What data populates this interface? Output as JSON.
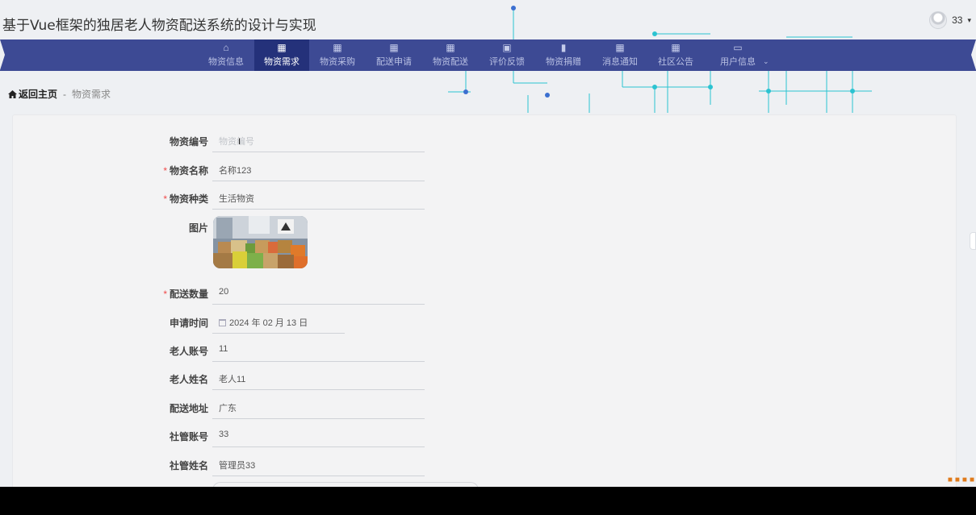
{
  "app": {
    "title": "基于Vue框架的独居老人物资配送系统的设计与实现"
  },
  "user": {
    "name": "33",
    "caret": "▾"
  },
  "nav": {
    "items": [
      {
        "label": "物资信息",
        "icon": "house-icon",
        "glyph": "⌂"
      },
      {
        "label": "物资需求",
        "icon": "grid-icon",
        "glyph": "▦",
        "active": true
      },
      {
        "label": "物资采购",
        "icon": "grid-icon",
        "glyph": "▦"
      },
      {
        "label": "配送申请",
        "icon": "grid-icon",
        "glyph": "▦"
      },
      {
        "label": "物资配送",
        "icon": "grid-dense-icon",
        "glyph": "▦"
      },
      {
        "label": "评价反馈",
        "icon": "clipboard-icon",
        "glyph": "▣"
      },
      {
        "label": "物资捐赠",
        "icon": "bar-chart-icon",
        "glyph": "▮"
      },
      {
        "label": "消息通知",
        "icon": "grid-icon",
        "glyph": "▦"
      },
      {
        "label": "社区公告",
        "icon": "grid-icon",
        "glyph": "▦"
      },
      {
        "label": "用户信息",
        "icon": "window-icon",
        "glyph": "▭"
      }
    ],
    "dropdown_glyph": "⌄"
  },
  "breadcrumb": {
    "home": "返回主页",
    "separator": "-",
    "current": "物资需求"
  },
  "form": {
    "fields": [
      {
        "key": "code",
        "label": "物资编号",
        "required": false,
        "value": "",
        "placeholder": "物资编号"
      },
      {
        "key": "name",
        "label": "物资名称",
        "required": true,
        "value": "名称123"
      },
      {
        "key": "type",
        "label": "物资种类",
        "required": true,
        "value": "生活物资"
      },
      {
        "key": "image",
        "label": "图片",
        "required": false
      },
      {
        "key": "qty",
        "label": "配送数量",
        "required": true,
        "value": "20"
      },
      {
        "key": "date",
        "label": "申请时间",
        "required": false,
        "value": "2024 年 02 月 13 日"
      },
      {
        "key": "elder_account",
        "label": "老人账号",
        "required": false,
        "value": "11"
      },
      {
        "key": "elder_name",
        "label": "老人姓名",
        "required": false,
        "value": "老人11"
      },
      {
        "key": "address",
        "label": "配送地址",
        "required": false,
        "value": "广东"
      },
      {
        "key": "manager_account",
        "label": "社管账号",
        "required": false,
        "value": "33"
      },
      {
        "key": "manager_name",
        "label": "社管姓名",
        "required": false,
        "value": "管理员33"
      }
    ],
    "required_mark": "*"
  },
  "colors": {
    "nav_bg": "#3d4a94",
    "nav_active": "#24317a",
    "circuit": "#2bc3d1",
    "required": "#f04a4a"
  }
}
